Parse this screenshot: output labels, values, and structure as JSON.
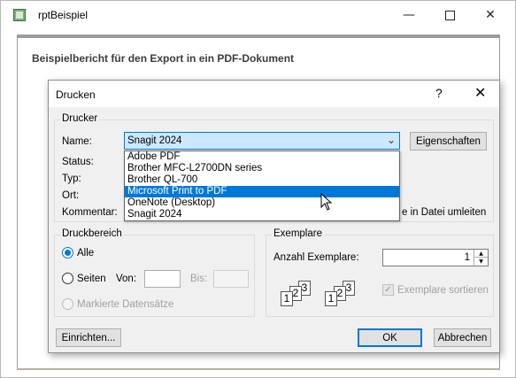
{
  "outer_window": {
    "title": "rptBeispiel",
    "report_heading": "Beispielbericht für den Export in ein PDF-Dokument"
  },
  "dialog": {
    "title": "Drucken",
    "help": "?",
    "printer_group": {
      "title": "Drucker",
      "name_label": "Name:",
      "selected_printer": "Snagit 2024",
      "status_label": "Status:",
      "type_label": "Typ:",
      "location_label": "Ort:",
      "comment_label": "Kommentar:",
      "properties_button": "Eigenschaften",
      "redirect_partial": "e in Datei umleiten",
      "dropdown_items": [
        "Adobe PDF",
        "Brother MFC-L2700DN series",
        "Brother QL-700",
        "Microsoft Print to PDF",
        "OneNote (Desktop)",
        "Snagit 2024"
      ],
      "highlighted_item": "Microsoft Print to PDF"
    },
    "range_group": {
      "title": "Druckbereich",
      "all_label": "Alle",
      "pages_label": "Seiten",
      "from_label": "Von:",
      "to_label": "Bis:",
      "selection_label": "Markierte Datensätze",
      "selected_option": "Alle"
    },
    "copies_group": {
      "title": "Exemplare",
      "count_label": "Anzahl Exemplare:",
      "count_value": "1",
      "collate_label": "Exemplare sortieren",
      "collate_checked": true,
      "collate_sheets": [
        "1",
        "2",
        "3"
      ]
    },
    "setup_button": "Einrichten...",
    "ok_button": "OK",
    "cancel_button": "Abbrechen"
  },
  "colors": {
    "accent": "#0078d7",
    "combo_highlight": "#cce8ff",
    "dialog_bg": "#f0f0f0"
  }
}
